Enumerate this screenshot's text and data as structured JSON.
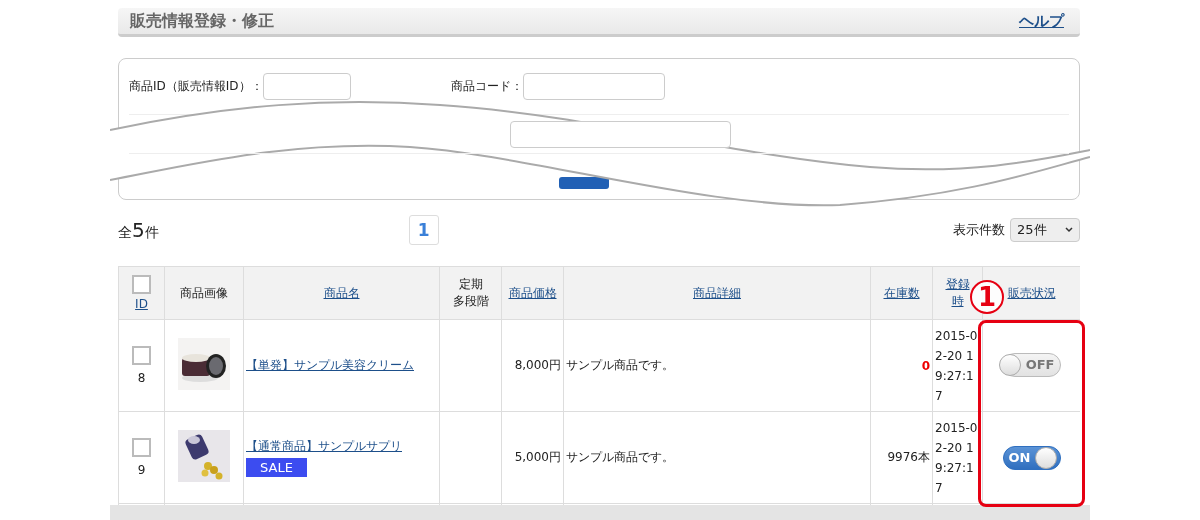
{
  "page": {
    "title": "販売情報登録・修正",
    "help_link": "ヘルプ"
  },
  "search": {
    "fields": [
      {
        "label": "商品ID（販売情報ID）："
      },
      {
        "label": "商品コード："
      }
    ]
  },
  "summary": {
    "total_prefix": "全",
    "total_count": "5",
    "total_suffix": "件"
  },
  "pagination": [
    {
      "label": "1",
      "selected": true
    }
  ],
  "per_page": {
    "label": "表示件数",
    "value": "25件"
  },
  "table": {
    "select_all_checked": false,
    "columns": [
      {
        "lines": [
          "ID"
        ],
        "sortable": true
      },
      {
        "lines": [
          "商品画像"
        ],
        "sortable": false
      },
      {
        "lines": [
          "商品名"
        ],
        "sortable": true
      },
      {
        "lines": [
          "定期",
          "多段階"
        ],
        "sortable": false
      },
      {
        "lines": [
          "商品価格"
        ],
        "sortable": true
      },
      {
        "lines": [
          "商品詳細"
        ],
        "sortable": true
      },
      {
        "lines": [
          "在庫数"
        ],
        "sortable": true
      },
      {
        "lines": [
          "登録",
          "時"
        ],
        "sortable": true
      },
      {
        "lines": [
          "販売状況"
        ],
        "sortable": true
      }
    ],
    "rows": [
      {
        "id": "8",
        "checked": false,
        "name": "【単発】サンプル美容クリーム",
        "price": "8,000円",
        "detail": "サンプル商品です。",
        "stock": "0",
        "out_of_stock": true,
        "registered": "2015-02-20 19:27:17",
        "on": false,
        "toggle_label": "OFF"
      },
      {
        "id": "9",
        "checked": false,
        "name": "【通常商品】サンプルサプリ",
        "badge": "SALE",
        "price": "5,000円",
        "detail": "サンプル商品です。",
        "stock": "9976本",
        "out_of_stock": false,
        "registered": "2015-02-20 19:27:17",
        "on": true,
        "toggle_label": "ON"
      }
    ]
  },
  "annotation": {
    "callout": "1"
  }
}
